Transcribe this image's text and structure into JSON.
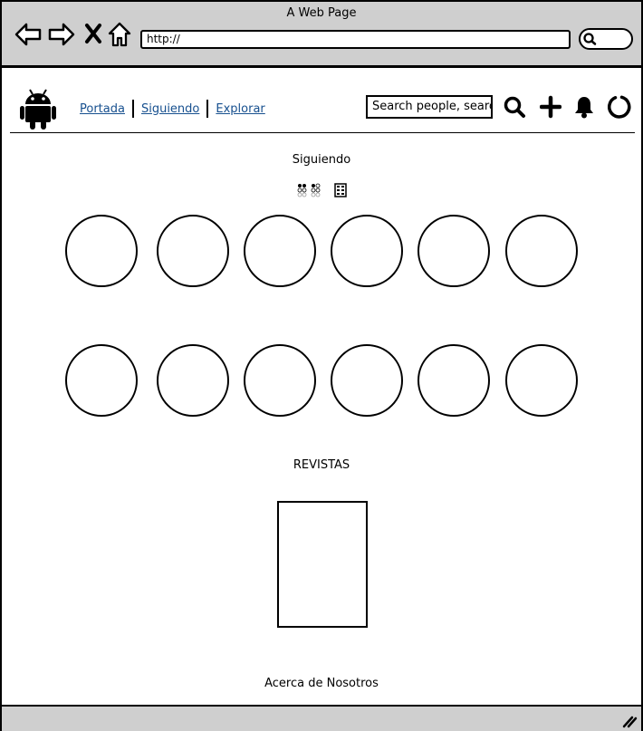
{
  "browser": {
    "window_title": "A Web Page",
    "url": "http://"
  },
  "app": {
    "nav": [
      "Portada",
      "Siguiendo",
      "Explorar"
    ],
    "search_placeholder": "Search people, search",
    "link_color": "#17508f"
  },
  "main": {
    "following_title": "Siguiendo",
    "magazines_title": "REVISTAS",
    "following_count": 12,
    "magazines_count": 1
  },
  "footer": {
    "about": "Acerca de Nosotros"
  },
  "icons": [
    "back-arrow-icon",
    "forward-arrow-icon",
    "close-icon",
    "home-icon",
    "android-logo-icon",
    "search-icon",
    "plus-icon",
    "bell-icon",
    "loading-icon",
    "grid-view-icon",
    "list-view-icon",
    "resize-grip-icon"
  ]
}
